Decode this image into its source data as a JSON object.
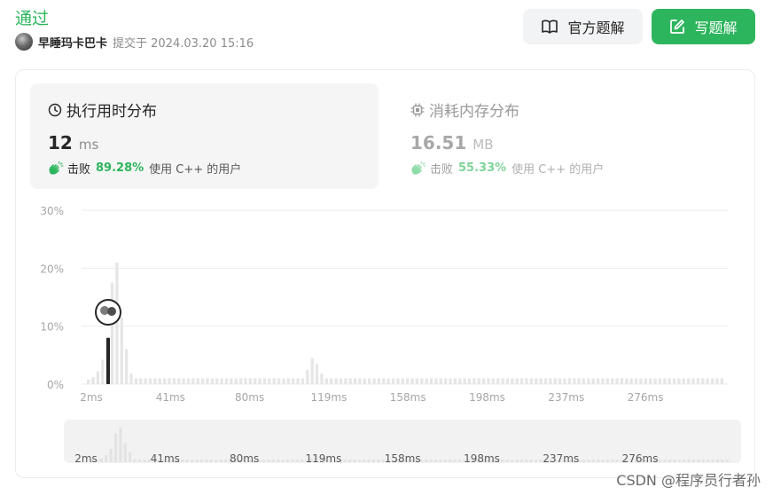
{
  "status": {
    "title": "通过"
  },
  "submission": {
    "user": "早睡玛卡巴卡",
    "time_text": "提交于 2024.03.20 15:16"
  },
  "buttons": {
    "solution": "官方题解",
    "write": "写题解"
  },
  "accent": "#2db55d",
  "runtime": {
    "title": "执行用时分布",
    "value": "12",
    "unit": "ms",
    "beat_prefix": "击败",
    "beat_pct": "89.28%",
    "beat_suffix": "使用 C++ 的用户"
  },
  "memory": {
    "title": "消耗内存分布",
    "value": "16.51",
    "unit": "MB",
    "beat_prefix": "击败",
    "beat_pct": "55.33%",
    "beat_suffix": "使用 C++ 的用户"
  },
  "watermark": "CSDN @程序员行者孙",
  "chart_data": {
    "type": "bar",
    "title": "",
    "xlabel": "",
    "ylabel": "",
    "ylim": [
      0,
      30
    ],
    "y_ticks": [
      "0%",
      "10%",
      "20%",
      "30%"
    ],
    "x_ticks": [
      "2ms",
      "41ms",
      "80ms",
      "119ms",
      "158ms",
      "198ms",
      "237ms",
      "276ms"
    ],
    "highlight_value_ms": 12,
    "highlight_percent": 8,
    "values": [
      0.8,
      1.2,
      2.2,
      4.2,
      8.0,
      17.5,
      21.0,
      11.5,
      6.0,
      1.8,
      1.0,
      1.0,
      1.0,
      1.0,
      1.0,
      1.0,
      1.0,
      1.0,
      1.0,
      1.0,
      1.0,
      1.0,
      1.0,
      1.0,
      1.0,
      1.0,
      1.0,
      1.0,
      1.0,
      1.0,
      1.0,
      1.0,
      1.0,
      1.0,
      1.0,
      1.0,
      1.0,
      1.0,
      1.0,
      1.0,
      1.0,
      1.0,
      1.0,
      1.0,
      1.0,
      1.0,
      2.5,
      4.5,
      3.5,
      1.8,
      1.0,
      1.0,
      1.0,
      1.0,
      1.0,
      1.0,
      1.0,
      1.0,
      1.0,
      1.0,
      1.0,
      1.0,
      1.0,
      1.0,
      1.0,
      1.0,
      1.0,
      1.0,
      1.0,
      1.0,
      1.0,
      1.0,
      1.0,
      1.0,
      1.0,
      1.0,
      1.0,
      1.0,
      1.0,
      1.0,
      1.0,
      1.0,
      1.0,
      1.0,
      1.0,
      1.0,
      1.0,
      1.0,
      1.0,
      1.0,
      1.0,
      1.0,
      1.0,
      1.0,
      1.0,
      1.0,
      1.0,
      1.0,
      1.0,
      1.0,
      1.0,
      1.0,
      1.0,
      1.0,
      1.0,
      1.0,
      1.0,
      1.0,
      1.0,
      1.0,
      1.0,
      1.0,
      1.0,
      1.0,
      1.0,
      1.0,
      1.0,
      1.0,
      1.0,
      1.0,
      1.0,
      1.0,
      1.0,
      1.0,
      1.0,
      1.0,
      1.0,
      1.0,
      1.0,
      1.0,
      1.0,
      1.0,
      1.0,
      1.0
    ],
    "grid": true,
    "has_range_slider": true
  }
}
